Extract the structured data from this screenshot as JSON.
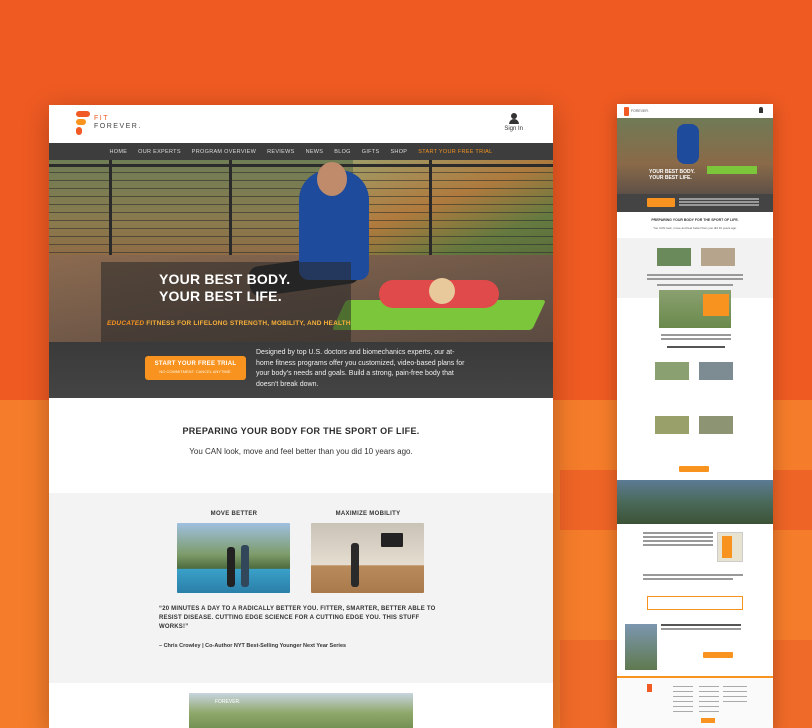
{
  "desktop": {
    "logo": {
      "line1": "FIT",
      "line2": "FOREVER."
    },
    "signin": "Sign In",
    "nav": [
      "HOME",
      "OUR EXPERTS",
      "PROGRAM OVERVIEW",
      "REVIEWS",
      "NEWS",
      "BLOG",
      "GIFTS",
      "SHOP"
    ],
    "nav_cta": "START YOUR FREE TRIAL",
    "hero": {
      "headline1": "YOUR BEST BODY.",
      "headline2": "YOUR BEST LIFE.",
      "tag_em": "EDUCATED",
      "tag_rest": " FITNESS FOR LIFELONG STRENGTH, MOBILITY, AND HEALTH"
    },
    "cta_bar": {
      "button": "START YOUR FREE TRIAL",
      "button_sub": "NO COMMITMENT. CANCEL ANYTIME.",
      "description": "Designed by top U.S. doctors and biomechanics experts, our at-home fitness programs offer you customized, video-based plans for your body's needs and goals. Build a strong, pain-free body that doesn't break down."
    },
    "section1": {
      "heading": "PREPARING YOUR BODY FOR THE SPORT OF LIFE.",
      "text": "You CAN look, move and feel better than you did 10 years ago."
    },
    "section2": {
      "col1": "MOVE BETTER",
      "col2": "MAXIMIZE MOBILITY",
      "quote": "“20 MINUTES A DAY TO A RADICALLY BETTER YOU. FITTER, SMARTER, BETTER ABLE TO RESIST DISEASE. CUTTING EDGE SCIENCE FOR A CUTTING EDGE YOU. THIS STUFF WORKS!”",
      "attribution": "– Chris Crowley | Co-Author NYT Best-Selling Younger Next Year Series"
    },
    "section3": {
      "thumb_text": "FOREVER."
    }
  },
  "mobile": {
    "logo": "FOREVER.",
    "hero": "YOUR BEST BODY. YOUR BEST LIFE.",
    "heading": "PREPARING YOUR BODY FOR THE SPORT OF LIFE.",
    "text": "You CAN look, move and feel better than you did 10 years ago."
  },
  "colors": {
    "brand_orange": "#f15a24",
    "accent": "#f7931e",
    "dark_bar": "#3d3d3d"
  }
}
